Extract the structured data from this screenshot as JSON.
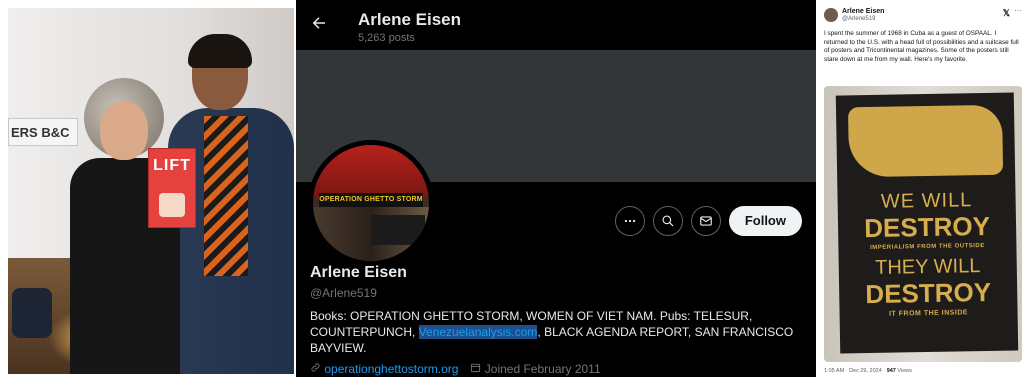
{
  "photo": {
    "wall_sign": "ERS B&C",
    "book_title": "LIFT"
  },
  "profile": {
    "header_name": "Arlene Eisen",
    "post_count": "5,263 posts",
    "avatar_text": "OPERATION GHETTO STORM",
    "display_name": "Arlene Eisen",
    "handle": "@Arlene519",
    "follow_label": "Follow",
    "bio_before": "Books: OPERATION GHETTO STORM, WOMEN OF VIET NAM. Pubs: TELESUR, COUNTERPUNCH, ",
    "bio_link": "Venezuelanalysis.com",
    "bio_after": ", BLACK AGENDA REPORT, SAN FRANCISCO BAYVIEW.",
    "website": "operationghettostorm.org",
    "joined": "Joined February 2011"
  },
  "tweet": {
    "name": "Arlene Eisen",
    "handle": "@Arlene519",
    "text": "I spent the summer of 1968 in Cuba as a guest of OSPAAL. I returned to the U.S. with a head full of possibilities and a suitcase full of posters and Tricontinental magazines. Some of the posters still stare down at me from my wall. Here's my favorite.",
    "poster": {
      "line1": "WE WILL",
      "line2": "DESTROY",
      "line3": "IMPERIALISM FROM THE OUTSIDE",
      "line4": "THEY WILL",
      "line5": "DESTROY",
      "line6": "IT FROM THE INSIDE"
    },
    "timestamp": "1:05 AM · Dec 29, 2024 · ",
    "views_count": "947",
    "views_label": " Views"
  }
}
